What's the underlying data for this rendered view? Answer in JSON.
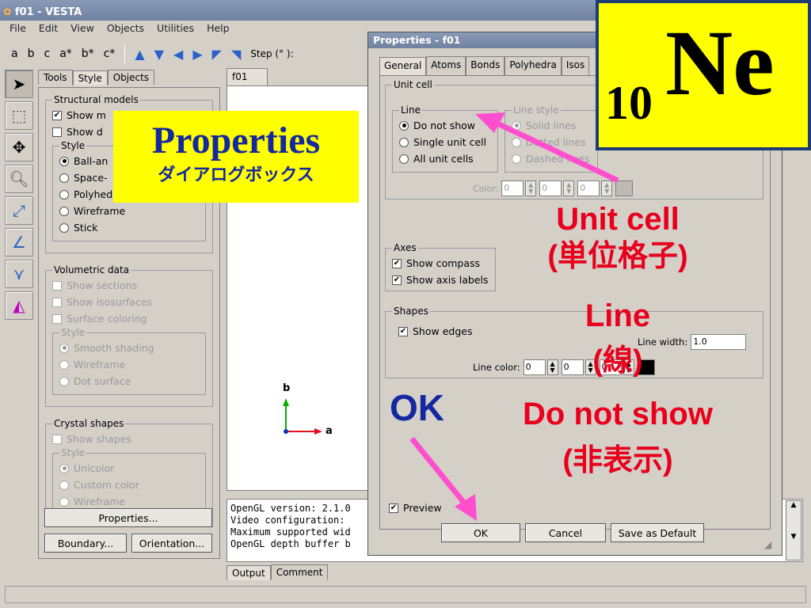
{
  "window": {
    "title": "f01 - VESTA"
  },
  "menu": [
    "File",
    "Edit",
    "View",
    "Objects",
    "Utilities",
    "Help"
  ],
  "toolbar": {
    "axis_buttons": [
      "a",
      "b",
      "c",
      "a*",
      "b*",
      "c*"
    ],
    "step_label": "Step (° ):"
  },
  "side_tabs": [
    "Tools",
    "Style",
    "Objects"
  ],
  "structural_models": {
    "legend": "Structural models",
    "show_models": "Show m",
    "show_d": "Show d",
    "style_legend": "Style",
    "styles": [
      "Ball-an",
      "Space-",
      "Polyhed",
      "Wireframe",
      "Stick"
    ]
  },
  "volumetric": {
    "legend": "Volumetric data",
    "checks": [
      "Show sections",
      "Show isosurfaces",
      "Surface coloring"
    ],
    "style_legend": "Style",
    "styles": [
      "Smooth shading",
      "Wireframe",
      "Dot surface"
    ]
  },
  "crystal": {
    "legend": "Crystal shapes",
    "show_shapes": "Show shapes",
    "style_legend": "Style",
    "styles": [
      "Unicolor",
      "Custom color",
      "Wireframe"
    ]
  },
  "side_buttons": {
    "properties": "Properties...",
    "boundary": "Boundary...",
    "orientation": "Orientation..."
  },
  "viewer": {
    "tab": "f01",
    "axis_b": "b",
    "axis_a": "a"
  },
  "output": {
    "lines": [
      "OpenGL version: 2.1.0",
      "Video configuration:",
      "Maximum supported wid",
      "OpenGL depth buffer b"
    ],
    "tabs": [
      "Output",
      "Comment"
    ]
  },
  "dialog": {
    "title": "Properties - f01",
    "tabs": [
      "General",
      "Atoms",
      "Bonds",
      "Polyhedra",
      "Isos"
    ],
    "unit_cell_legend": "Unit cell",
    "line_legend": "Line",
    "line_options": [
      "Do not show",
      "Single unit cell",
      "All unit cells"
    ],
    "line_style_legend": "Line style",
    "line_styles": [
      "Solid lines",
      "Dotted lines",
      "Dashed lines"
    ],
    "color_label": "Color:",
    "color_values": [
      "0",
      "0",
      "0"
    ],
    "axes_legend": "Axes",
    "axes_checks": [
      "Show compass",
      "Show axis labels"
    ],
    "shapes_legend": "Shapes",
    "show_edges": "Show edges",
    "line_width_label": "Line width:",
    "line_width_value": "1.0",
    "line_color_label": "Line color:",
    "line_color_values": [
      "0",
      "0",
      "0"
    ],
    "preview": "Preview",
    "ok": "OK",
    "cancel": "Cancel",
    "save_default": "Save as Default"
  },
  "annotations": {
    "element_number": "10",
    "element_symbol": "Ne",
    "props_title": "Properties",
    "props_sub": "ダイアログボックス",
    "unit_cell": "Unit cell",
    "unit_cell_jp": "(単位格子)",
    "line": "Line",
    "line_jp": "(線)",
    "ok": "OK",
    "do_not_show": "Do not show",
    "do_not_show_jp": "(非表示)"
  },
  "colors": {
    "accent_blue": "#2a62c9",
    "annotation_red": "#e8001c",
    "callout_yellow": "#ffff00",
    "ok_blue": "#1428a0",
    "arrow_pink": "#ff4fcf"
  }
}
